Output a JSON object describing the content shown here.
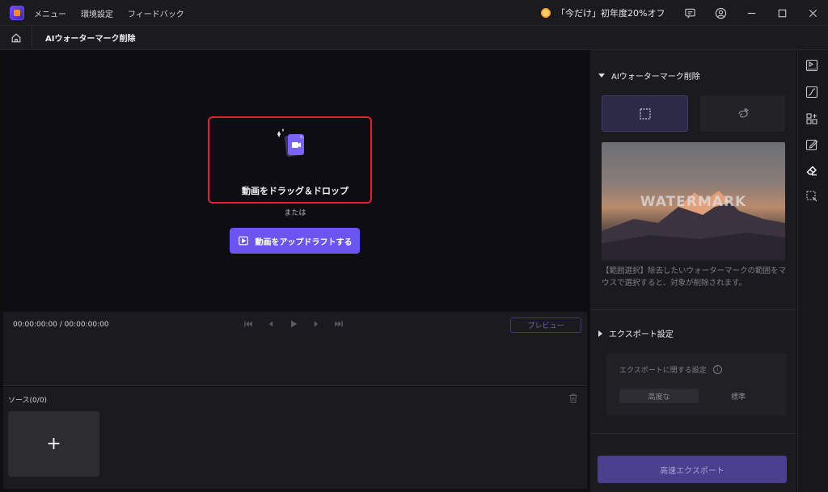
{
  "menu": {
    "items": [
      "メニュー",
      "環境設定",
      "フィードバック"
    ]
  },
  "promo": {
    "text": "「今だけ」初年度20%オフ"
  },
  "page": {
    "title": "AIウォーターマーク削除"
  },
  "drop": {
    "label": "動画をドラッグ＆ドロップ",
    "or": "または",
    "upload_label": "動画をアップドラフトする"
  },
  "timeline": {
    "timecode": "00:00:00:00 / 00:00:00:00",
    "preview_label": "プレビュー"
  },
  "source": {
    "title": "ソース(0/0)",
    "add_symbol": "+"
  },
  "panel": {
    "watermark_title": "AIウォーターマーク削除",
    "watermark_image_text": "WATERMARK",
    "watermark_desc": "【範囲選択】除去したいウォーターマークの範囲をマウスで選択すると、対象が削除されます。",
    "export_title": "エクスポート設定",
    "export_setting_label": "エクスポートに関する設定",
    "options": [
      "高度な",
      "標準"
    ],
    "export_button": "高速エクスポート"
  },
  "colors": {
    "accent": "#6b55f0",
    "highlight_border": "#e0222b"
  }
}
